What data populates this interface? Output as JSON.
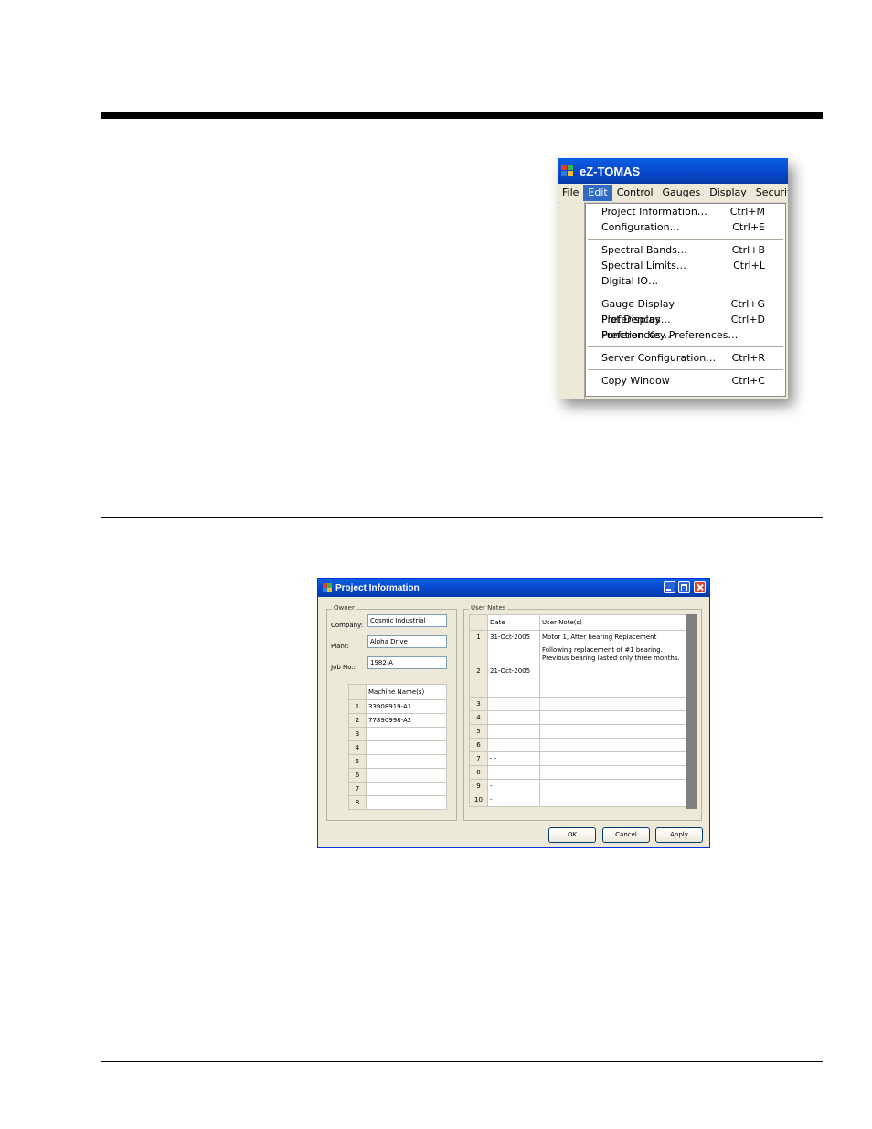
{
  "app_window": {
    "title": "eZ-TOMAS",
    "menu": [
      "File",
      "Edit",
      "Control",
      "Gauges",
      "Display",
      "Security"
    ],
    "active_menu": "Edit",
    "edit_menu_groups": [
      [
        {
          "label": "Project Information…",
          "shortcut": "Ctrl+M"
        },
        {
          "label": "Configuration…",
          "shortcut": "Ctrl+E"
        }
      ],
      [
        {
          "label": "Spectral Bands…",
          "shortcut": "Ctrl+B"
        },
        {
          "label": "Spectral Limits…",
          "shortcut": "Ctrl+L"
        },
        {
          "label": "Digital IO…",
          "shortcut": ""
        }
      ],
      [
        {
          "label": "Gauge Display Preferences…",
          "shortcut": "Ctrl+G"
        },
        {
          "label": "Plot Display Preferences…",
          "shortcut": "Ctrl+D"
        },
        {
          "label": "Function Key Preferences…",
          "shortcut": ""
        }
      ],
      [
        {
          "label": "Server Configuration…",
          "shortcut": "Ctrl+R"
        }
      ],
      [
        {
          "label": "Copy Window",
          "shortcut": "Ctrl+C"
        }
      ]
    ]
  },
  "dialog": {
    "title": "Project Information",
    "owner": {
      "legend": "Owner",
      "company_label": "Company:",
      "company_value": "Cosmic Industrial",
      "plant_label": "Plant:",
      "plant_value": "Alpha Drive",
      "jobno_label": "Job No.:",
      "jobno_value": "1982-A",
      "machine_header": "Machine Name(s)",
      "machines": [
        {
          "n": "1",
          "name": "33908919-A1"
        },
        {
          "n": "2",
          "name": "77890998-A2"
        },
        {
          "n": "3",
          "name": ""
        },
        {
          "n": "4",
          "name": ""
        },
        {
          "n": "5",
          "name": ""
        },
        {
          "n": "6",
          "name": ""
        },
        {
          "n": "7",
          "name": ""
        },
        {
          "n": "8",
          "name": ""
        }
      ]
    },
    "user_notes": {
      "legend": "User Notes",
      "date_header": "Date",
      "note_header": "User Note(s)",
      "rows": [
        {
          "n": "1",
          "date": "31-Oct-2005",
          "note": "Motor 1, After bearing Replacement"
        },
        {
          "n": "2",
          "date": "21-Oct-2005",
          "note": "Following replacement of #1 bearing. Previous bearing lasted only three months."
        },
        {
          "n": "3",
          "date": "",
          "note": ""
        },
        {
          "n": "4",
          "date": "",
          "note": ""
        },
        {
          "n": "5",
          "date": "",
          "note": ""
        },
        {
          "n": "6",
          "date": "",
          "note": ""
        },
        {
          "n": "7",
          "date": "- -",
          "note": ""
        },
        {
          "n": "8",
          "date": "-",
          "note": ""
        },
        {
          "n": "9",
          "date": "-",
          "note": ""
        },
        {
          "n": "10",
          "date": "-",
          "note": ""
        }
      ]
    },
    "buttons": {
      "ok": "OK",
      "cancel": "Cancel",
      "apply": "Apply"
    }
  }
}
